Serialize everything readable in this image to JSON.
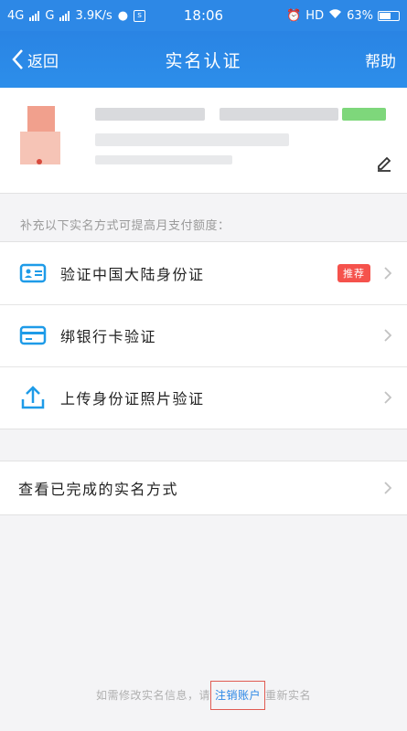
{
  "status_bar": {
    "net1": "4G",
    "net2": "G",
    "speed": "3.9K/s",
    "time": "18:06",
    "hd": "HD",
    "battery": "63%"
  },
  "nav": {
    "back_label": "返回",
    "title": "实名认证",
    "help_label": "帮助"
  },
  "hint": "补充以下实名方式可提高月支付额度：",
  "methods": [
    {
      "label": "验证中国大陆身份证",
      "badge": "推荐",
      "icon": "id-card-icon"
    },
    {
      "label": "绑银行卡验证",
      "icon": "bank-card-icon"
    },
    {
      "label": "上传身份证照片验证",
      "icon": "upload-icon"
    }
  ],
  "completed": {
    "label": "查看已完成的实名方式"
  },
  "footer": {
    "prefix": "如需修改实名信息，请",
    "link": "注销账户",
    "suffix": "重新实名"
  },
  "colors": {
    "accent": "#2d88e6",
    "badge": "#f5524c"
  }
}
